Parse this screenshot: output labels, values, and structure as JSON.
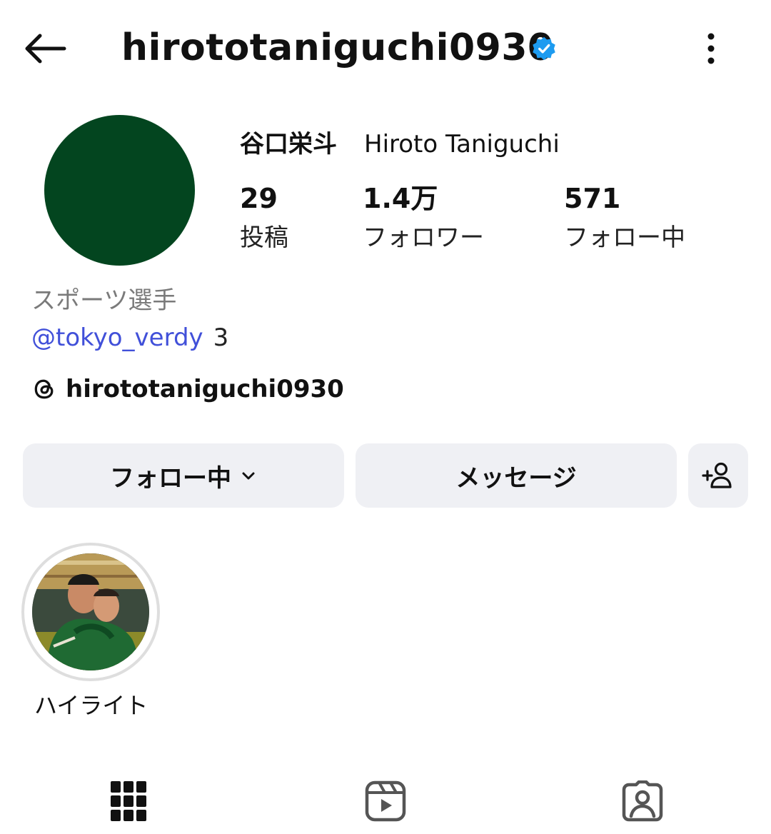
{
  "header": {
    "username": "hirototaniguchi0930"
  },
  "profile": {
    "name_jp": "谷口栄斗",
    "name_en": "Hiroto Taniguchi",
    "stats": [
      {
        "value": "29",
        "label": "投稿"
      },
      {
        "value": "1.4万",
        "label": "フォロワー"
      },
      {
        "value": "571",
        "label": "フォロー中"
      }
    ],
    "category": "スポーツ選手",
    "bio_link": "@tokyo_verdy",
    "bio_count": "3",
    "threads_handle": "hirototaniguchi0930"
  },
  "actions": {
    "following_label": "フォロー中",
    "message_label": "メッセージ"
  },
  "highlights": [
    {
      "label": "ハイライト"
    }
  ],
  "colors": {
    "avatar": "#03451f",
    "verified": "#1d9bf0",
    "link": "#4150d9",
    "button_bg": "#eff0f4"
  },
  "icons": [
    "back-arrow-icon",
    "verified-badge-icon",
    "more-vertical-icon",
    "threads-icon",
    "chevron-down-icon",
    "add-person-icon",
    "grid-icon",
    "reels-icon",
    "tagged-icon"
  ]
}
